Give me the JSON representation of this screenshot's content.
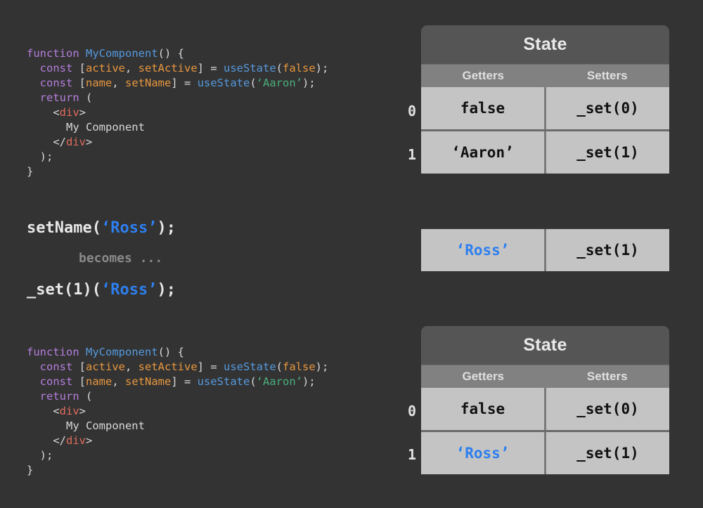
{
  "background_color": "#333333",
  "colors": {
    "keyword": "#b57edc",
    "function": "#5599dd",
    "variable": "#e8973f",
    "string": "#4caf7d",
    "tag": "#e06c5c",
    "plain": "#d8d8d8",
    "highlight_blue": "#2d7ff0",
    "table_title_bg": "#555555",
    "table_subhead_bg": "#818181",
    "table_cell_bg": "#c4c4c4"
  },
  "code_top": {
    "lines": [
      [
        {
          "t": "function ",
          "c": "keyword"
        },
        {
          "t": "MyComponent",
          "c": "function"
        },
        {
          "t": "() {",
          "c": "plain"
        }
      ],
      [
        {
          "t": "  const ",
          "c": "keyword"
        },
        {
          "t": "[",
          "c": "plain"
        },
        {
          "t": "active",
          "c": "var"
        },
        {
          "t": ", ",
          "c": "plain"
        },
        {
          "t": "setActive",
          "c": "var"
        },
        {
          "t": "] = ",
          "c": "plain"
        },
        {
          "t": "useState",
          "c": "function"
        },
        {
          "t": "(",
          "c": "plain"
        },
        {
          "t": "false",
          "c": "bool"
        },
        {
          "t": ");",
          "c": "plain"
        }
      ],
      [
        {
          "t": "  const ",
          "c": "keyword"
        },
        {
          "t": "[",
          "c": "plain"
        },
        {
          "t": "name",
          "c": "var"
        },
        {
          "t": ", ",
          "c": "plain"
        },
        {
          "t": "setName",
          "c": "var"
        },
        {
          "t": "] = ",
          "c": "plain"
        },
        {
          "t": "useState",
          "c": "function"
        },
        {
          "t": "(",
          "c": "plain"
        },
        {
          "t": "‘Aaron’",
          "c": "string"
        },
        {
          "t": ");",
          "c": "plain"
        }
      ],
      [
        {
          "t": "  return ",
          "c": "keyword"
        },
        {
          "t": "(",
          "c": "plain"
        }
      ],
      [
        {
          "t": "    <",
          "c": "plain"
        },
        {
          "t": "div",
          "c": "tag"
        },
        {
          "t": ">",
          "c": "plain"
        }
      ],
      [
        {
          "t": "      My Component",
          "c": "plain"
        }
      ],
      [
        {
          "t": "    </",
          "c": "plain"
        },
        {
          "t": "div",
          "c": "tag"
        },
        {
          "t": ">",
          "c": "plain"
        }
      ],
      [
        {
          "t": "  );",
          "c": "plain"
        }
      ],
      [
        {
          "t": "}",
          "c": "plain"
        }
      ]
    ]
  },
  "code_bottom": {
    "lines": [
      [
        {
          "t": "function ",
          "c": "keyword"
        },
        {
          "t": "MyComponent",
          "c": "function"
        },
        {
          "t": "() {",
          "c": "plain"
        }
      ],
      [
        {
          "t": "  const ",
          "c": "keyword"
        },
        {
          "t": "[",
          "c": "plain"
        },
        {
          "t": "active",
          "c": "var"
        },
        {
          "t": ", ",
          "c": "plain"
        },
        {
          "t": "setActive",
          "c": "var"
        },
        {
          "t": "] = ",
          "c": "plain"
        },
        {
          "t": "useState",
          "c": "function"
        },
        {
          "t": "(",
          "c": "plain"
        },
        {
          "t": "false",
          "c": "bool"
        },
        {
          "t": ");",
          "c": "plain"
        }
      ],
      [
        {
          "t": "  const ",
          "c": "keyword"
        },
        {
          "t": "[",
          "c": "plain"
        },
        {
          "t": "name",
          "c": "var"
        },
        {
          "t": ", ",
          "c": "plain"
        },
        {
          "t": "setName",
          "c": "var"
        },
        {
          "t": "] = ",
          "c": "plain"
        },
        {
          "t": "useState",
          "c": "function"
        },
        {
          "t": "(",
          "c": "plain"
        },
        {
          "t": "‘Aaron’",
          "c": "string"
        },
        {
          "t": ");",
          "c": "plain"
        }
      ],
      [
        {
          "t": "  return ",
          "c": "keyword"
        },
        {
          "t": "(",
          "c": "plain"
        }
      ],
      [
        {
          "t": "    <",
          "c": "plain"
        },
        {
          "t": "div",
          "c": "tag"
        },
        {
          "t": ">",
          "c": "plain"
        }
      ],
      [
        {
          "t": "      My Component",
          "c": "plain"
        }
      ],
      [
        {
          "t": "    </",
          "c": "plain"
        },
        {
          "t": "div",
          "c": "tag"
        },
        {
          "t": ">",
          "c": "plain"
        }
      ],
      [
        {
          "t": "  );",
          "c": "plain"
        }
      ],
      [
        {
          "t": "}",
          "c": "plain"
        }
      ]
    ]
  },
  "transform": {
    "before_prefix": "setName(",
    "before_arg": "‘Ross’",
    "before_suffix": ");",
    "becomes_label": "becomes ...",
    "after_prefix": "_set(1)(",
    "after_arg": "‘Ross’",
    "after_suffix": ");"
  },
  "table_top": {
    "title": "State",
    "columns": [
      "Getters",
      "Setters"
    ],
    "row_indices": [
      "0",
      "1"
    ],
    "rows": [
      {
        "getter": "false",
        "getter_highlight": false,
        "setter": "_set(0)"
      },
      {
        "getter": "‘Aaron’",
        "getter_highlight": false,
        "setter": "_set(1)"
      }
    ]
  },
  "lone_row": {
    "getter": "‘Ross’",
    "getter_highlight": true,
    "setter": "_set(1)"
  },
  "table_bottom": {
    "title": "State",
    "columns": [
      "Getters",
      "Setters"
    ],
    "row_indices": [
      "0",
      "1"
    ],
    "rows": [
      {
        "getter": "false",
        "getter_highlight": false,
        "setter": "_set(0)"
      },
      {
        "getter": "‘Ross’",
        "getter_highlight": true,
        "setter": "_set(1)"
      }
    ]
  }
}
